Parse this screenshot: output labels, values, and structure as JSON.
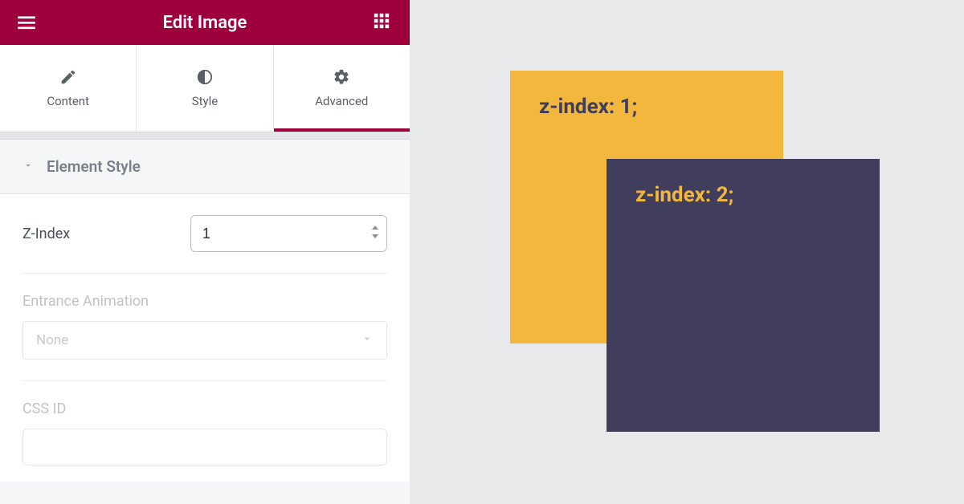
{
  "header": {
    "title": "Edit Image"
  },
  "tabs": [
    {
      "label": "Content"
    },
    {
      "label": "Style"
    },
    {
      "label": "Advanced"
    }
  ],
  "section": {
    "title": "Element Style"
  },
  "fields": {
    "zindex_label": "Z-Index",
    "zindex_value": "1",
    "entrance_label": "Entrance Animation",
    "entrance_value": "None",
    "cssid_label": "CSS ID"
  },
  "preview": {
    "box1": "z-index: 1;",
    "box2": "z-index: 2;"
  }
}
